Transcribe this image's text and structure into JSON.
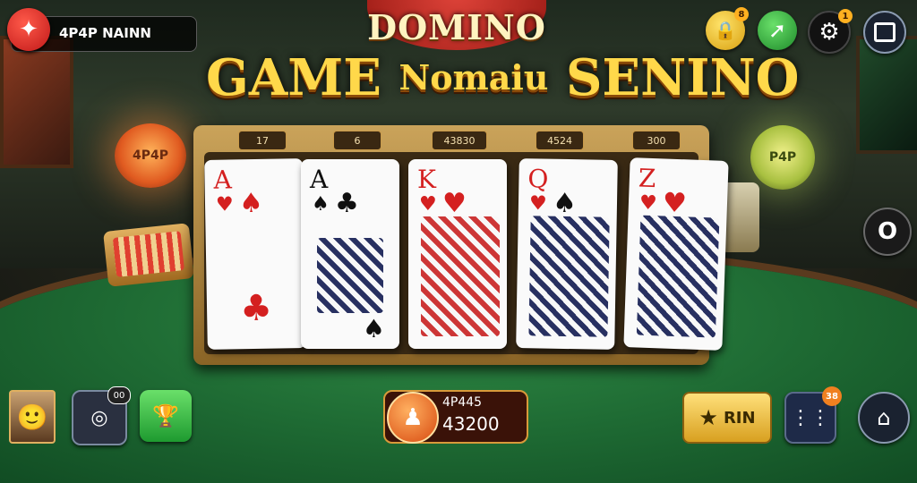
{
  "header": {
    "title_top": "DOMINO",
    "title_left": "GAME",
    "title_mid": "Nomaiu",
    "title_right": "SENINO"
  },
  "profile": {
    "name": "4P4P NAINN",
    "brand_icon": "brand-logo-icon"
  },
  "top_right": {
    "lock_badge": "8",
    "settings_badge": "1",
    "icons": [
      "lock-icon",
      "share-arrow-icon",
      "gear-icon",
      "chat-icon"
    ]
  },
  "side_button": {
    "label": "O"
  },
  "decor": {
    "lantern_left": "4P4P",
    "lantern_right": "P4P"
  },
  "board": {
    "labels": [
      "17",
      "6",
      "43830",
      "4524",
      "300"
    ]
  },
  "cards": [
    {
      "rank": "A",
      "suit": "♠",
      "color": "red",
      "center": "♣"
    },
    {
      "rank": "A",
      "suit": "♣",
      "color": "black",
      "center": "♠"
    },
    {
      "rank": "K",
      "suit": "♥",
      "color": "red",
      "center": ""
    },
    {
      "rank": "Q",
      "suit": "♠",
      "color": "red",
      "center": ""
    },
    {
      "rank": "Z",
      "suit": "♥",
      "color": "red",
      "center": ""
    }
  ],
  "bottom": {
    "voice_badge": "00",
    "coin_label": "4P445",
    "coin_value": "43200",
    "win_label": "RIN",
    "menu_badge": "38"
  },
  "colors": {
    "felt": "#1e6a33",
    "gold": "#ffd84a",
    "board_wood": "#caa35a"
  }
}
